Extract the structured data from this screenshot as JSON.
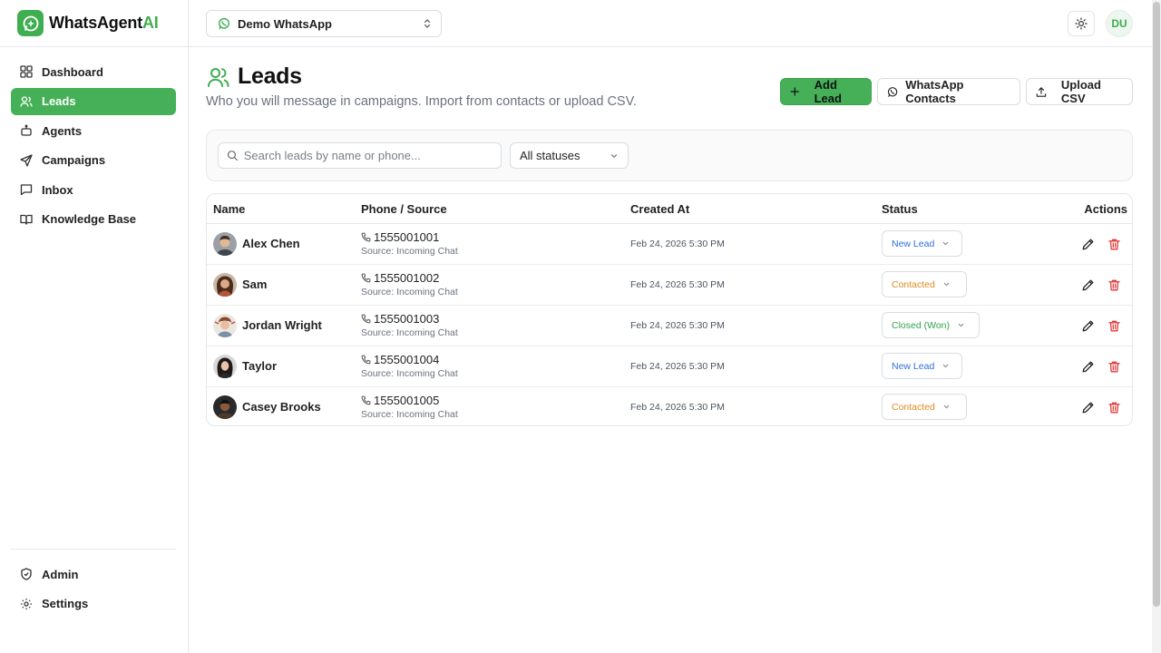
{
  "brand": {
    "name_main": "WhatsAgent",
    "name_accent": "AI"
  },
  "sidebar": {
    "items": [
      {
        "label": "Dashboard",
        "icon": "dashboard-icon",
        "active": false
      },
      {
        "label": "Leads",
        "icon": "users-icon",
        "active": true
      },
      {
        "label": "Agents",
        "icon": "bot-icon",
        "active": false
      },
      {
        "label": "Campaigns",
        "icon": "send-icon",
        "active": false
      },
      {
        "label": "Inbox",
        "icon": "message-icon",
        "active": false
      },
      {
        "label": "Knowledge Base",
        "icon": "book-icon",
        "active": false
      }
    ],
    "bottom": [
      {
        "label": "Admin",
        "icon": "shield-icon"
      },
      {
        "label": "Settings",
        "icon": "gear-icon"
      }
    ]
  },
  "topbar": {
    "workspace": "Demo WhatsApp",
    "user_initials": "DU"
  },
  "page": {
    "title": "Leads",
    "subtitle": "Who you will message in campaigns. Import from contacts or upload CSV.",
    "add_lead": "Add Lead",
    "whatsapp_contacts": "WhatsApp Contacts",
    "upload_csv": "Upload CSV"
  },
  "filters": {
    "search_placeholder": "Search leads by name or phone...",
    "status": "All statuses"
  },
  "table": {
    "headers": {
      "name": "Name",
      "phone": "Phone / Source",
      "created": "Created At",
      "status": "Status",
      "actions": "Actions"
    },
    "rows": [
      {
        "name": "Alex Chen",
        "phone": "1555001001",
        "source": "Source: Incoming Chat",
        "created": "Feb 24, 2026 5:30 PM",
        "status": "New Lead"
      },
      {
        "name": "Sam",
        "phone": "1555001002",
        "source": "Source: Incoming Chat",
        "created": "Feb 24, 2026 5:30 PM",
        "status": "Contacted"
      },
      {
        "name": "Jordan Wright",
        "phone": "1555001003",
        "source": "Source: Incoming Chat",
        "created": "Feb 24, 2026 5:30 PM",
        "status": "Closed (Won)"
      },
      {
        "name": "Taylor",
        "phone": "1555001004",
        "source": "Source: Incoming Chat",
        "created": "Feb 24, 2026 5:30 PM",
        "status": "New Lead"
      },
      {
        "name": "Casey Brooks",
        "phone": "1555001005",
        "source": "Source: Incoming Chat",
        "created": "Feb 24, 2026 5:30 PM",
        "status": "Contacted"
      }
    ]
  },
  "colors": {
    "accent": "#45b057",
    "new_lead": "#2f6fe0",
    "contacted": "#e08a1e",
    "won": "#2ea44f",
    "delete": "#e03b3b"
  }
}
